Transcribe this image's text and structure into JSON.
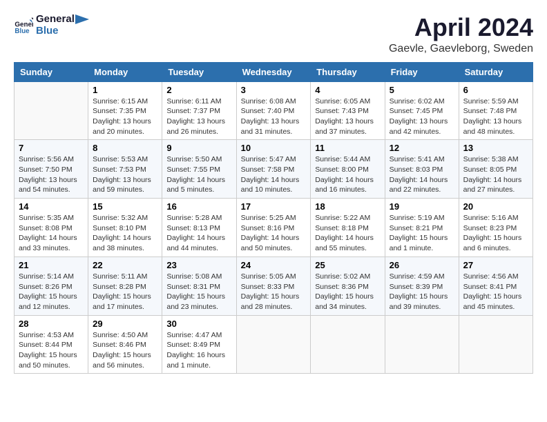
{
  "header": {
    "logo_line1": "General",
    "logo_line2": "Blue",
    "month": "April 2024",
    "location": "Gaevle, Gaevleborg, Sweden"
  },
  "columns": [
    "Sunday",
    "Monday",
    "Tuesday",
    "Wednesday",
    "Thursday",
    "Friday",
    "Saturday"
  ],
  "weeks": [
    [
      {
        "day": "",
        "info": ""
      },
      {
        "day": "1",
        "info": "Sunrise: 6:15 AM\nSunset: 7:35 PM\nDaylight: 13 hours\nand 20 minutes."
      },
      {
        "day": "2",
        "info": "Sunrise: 6:11 AM\nSunset: 7:37 PM\nDaylight: 13 hours\nand 26 minutes."
      },
      {
        "day": "3",
        "info": "Sunrise: 6:08 AM\nSunset: 7:40 PM\nDaylight: 13 hours\nand 31 minutes."
      },
      {
        "day": "4",
        "info": "Sunrise: 6:05 AM\nSunset: 7:43 PM\nDaylight: 13 hours\nand 37 minutes."
      },
      {
        "day": "5",
        "info": "Sunrise: 6:02 AM\nSunset: 7:45 PM\nDaylight: 13 hours\nand 42 minutes."
      },
      {
        "day": "6",
        "info": "Sunrise: 5:59 AM\nSunset: 7:48 PM\nDaylight: 13 hours\nand 48 minutes."
      }
    ],
    [
      {
        "day": "7",
        "info": "Sunrise: 5:56 AM\nSunset: 7:50 PM\nDaylight: 13 hours\nand 54 minutes."
      },
      {
        "day": "8",
        "info": "Sunrise: 5:53 AM\nSunset: 7:53 PM\nDaylight: 13 hours\nand 59 minutes."
      },
      {
        "day": "9",
        "info": "Sunrise: 5:50 AM\nSunset: 7:55 PM\nDaylight: 14 hours\nand 5 minutes."
      },
      {
        "day": "10",
        "info": "Sunrise: 5:47 AM\nSunset: 7:58 PM\nDaylight: 14 hours\nand 10 minutes."
      },
      {
        "day": "11",
        "info": "Sunrise: 5:44 AM\nSunset: 8:00 PM\nDaylight: 14 hours\nand 16 minutes."
      },
      {
        "day": "12",
        "info": "Sunrise: 5:41 AM\nSunset: 8:03 PM\nDaylight: 14 hours\nand 22 minutes."
      },
      {
        "day": "13",
        "info": "Sunrise: 5:38 AM\nSunset: 8:05 PM\nDaylight: 14 hours\nand 27 minutes."
      }
    ],
    [
      {
        "day": "14",
        "info": "Sunrise: 5:35 AM\nSunset: 8:08 PM\nDaylight: 14 hours\nand 33 minutes."
      },
      {
        "day": "15",
        "info": "Sunrise: 5:32 AM\nSunset: 8:10 PM\nDaylight: 14 hours\nand 38 minutes."
      },
      {
        "day": "16",
        "info": "Sunrise: 5:28 AM\nSunset: 8:13 PM\nDaylight: 14 hours\nand 44 minutes."
      },
      {
        "day": "17",
        "info": "Sunrise: 5:25 AM\nSunset: 8:16 PM\nDaylight: 14 hours\nand 50 minutes."
      },
      {
        "day": "18",
        "info": "Sunrise: 5:22 AM\nSunset: 8:18 PM\nDaylight: 14 hours\nand 55 minutes."
      },
      {
        "day": "19",
        "info": "Sunrise: 5:19 AM\nSunset: 8:21 PM\nDaylight: 15 hours\nand 1 minute."
      },
      {
        "day": "20",
        "info": "Sunrise: 5:16 AM\nSunset: 8:23 PM\nDaylight: 15 hours\nand 6 minutes."
      }
    ],
    [
      {
        "day": "21",
        "info": "Sunrise: 5:14 AM\nSunset: 8:26 PM\nDaylight: 15 hours\nand 12 minutes."
      },
      {
        "day": "22",
        "info": "Sunrise: 5:11 AM\nSunset: 8:28 PM\nDaylight: 15 hours\nand 17 minutes."
      },
      {
        "day": "23",
        "info": "Sunrise: 5:08 AM\nSunset: 8:31 PM\nDaylight: 15 hours\nand 23 minutes."
      },
      {
        "day": "24",
        "info": "Sunrise: 5:05 AM\nSunset: 8:33 PM\nDaylight: 15 hours\nand 28 minutes."
      },
      {
        "day": "25",
        "info": "Sunrise: 5:02 AM\nSunset: 8:36 PM\nDaylight: 15 hours\nand 34 minutes."
      },
      {
        "day": "26",
        "info": "Sunrise: 4:59 AM\nSunset: 8:39 PM\nDaylight: 15 hours\nand 39 minutes."
      },
      {
        "day": "27",
        "info": "Sunrise: 4:56 AM\nSunset: 8:41 PM\nDaylight: 15 hours\nand 45 minutes."
      }
    ],
    [
      {
        "day": "28",
        "info": "Sunrise: 4:53 AM\nSunset: 8:44 PM\nDaylight: 15 hours\nand 50 minutes."
      },
      {
        "day": "29",
        "info": "Sunrise: 4:50 AM\nSunset: 8:46 PM\nDaylight: 15 hours\nand 56 minutes."
      },
      {
        "day": "30",
        "info": "Sunrise: 4:47 AM\nSunset: 8:49 PM\nDaylight: 16 hours\nand 1 minute."
      },
      {
        "day": "",
        "info": ""
      },
      {
        "day": "",
        "info": ""
      },
      {
        "day": "",
        "info": ""
      },
      {
        "day": "",
        "info": ""
      }
    ]
  ]
}
